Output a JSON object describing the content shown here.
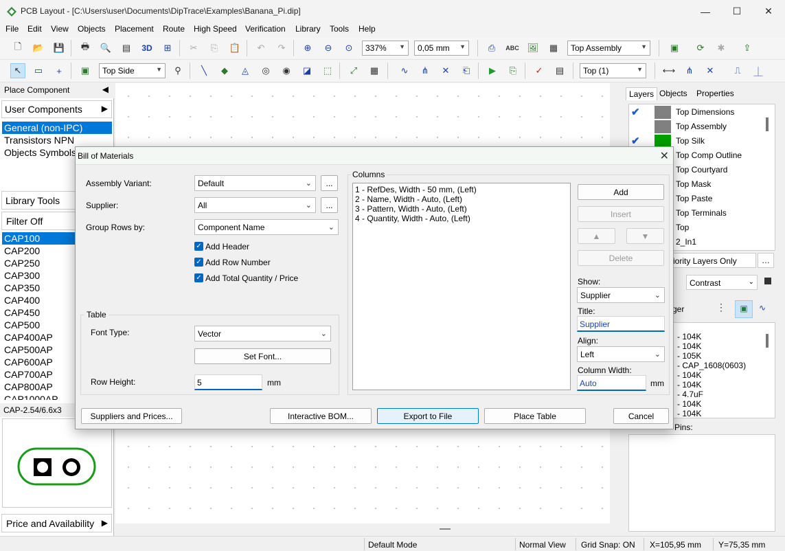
{
  "window": {
    "title": "PCB Layout - [C:\\Users\\user\\Documents\\DipTrace\\Examples\\Banana_Pi.dip]",
    "minimize": "—",
    "maximize": "☐",
    "close": "✕"
  },
  "menu": [
    "File",
    "Edit",
    "View",
    "Objects",
    "Placement",
    "Route",
    "High Speed",
    "Verification",
    "Library",
    "Tools",
    "Help"
  ],
  "toolbar1": {
    "zoom": "337%",
    "grid": "0,05 mm",
    "assembly": "Top Assembly",
    "abc": "ABC",
    "three_d": "3D"
  },
  "toolbar2": {
    "side": "Top Side",
    "layer": "Top (1)"
  },
  "left_panel": {
    "place_component": "Place Component",
    "user_components": "User Components",
    "libraries": [
      "General (non-IPC)",
      "Transistors NPN",
      "Objects Symbols"
    ],
    "library_tools": "Library Tools",
    "filter": "Filter Off",
    "components": [
      "CAP100",
      "CAP200",
      "CAP250",
      "CAP300",
      "CAP350",
      "CAP400",
      "CAP450",
      "CAP500",
      "CAP400AP",
      "CAP500AP",
      "CAP600AP",
      "CAP700AP",
      "CAP800AP",
      "CAP1000AP"
    ],
    "pattern_name": "CAP-2.54/6.6x3",
    "price_availability": "Price and Availability"
  },
  "right_panel": {
    "tabs": [
      "Layers",
      "Objects",
      "Properties"
    ],
    "layers": [
      {
        "name": "Top Dimensions",
        "checked": true,
        "color": "#808080"
      },
      {
        "name": "Top Assembly",
        "checked": false,
        "color": "#808080"
      },
      {
        "name": "Top Silk",
        "checked": true,
        "color": "#00a000"
      },
      {
        "name": "Top Comp Outline",
        "checked": false,
        "color": "#ffffff"
      },
      {
        "name": "Top Courtyard",
        "checked": false,
        "color": "#ffffff"
      },
      {
        "name": "Top Mask",
        "checked": false,
        "color": "#ffffff"
      },
      {
        "name": "Top Paste",
        "checked": false,
        "color": "#ffffff"
      },
      {
        "name": "Top Terminals",
        "checked": false,
        "color": "#ffffff"
      },
      {
        "name": "Top",
        "checked": false,
        "color": "#ffffff"
      },
      {
        "name": "2_In1",
        "checked": false,
        "color": "#ffffff"
      }
    ],
    "priority": "iority Layers Only",
    "contrast": "Contrast",
    "manager": "ger",
    "components": [
      "- 104K",
      "- 104K",
      "- 105K",
      "- CAP_1608(0603)",
      "- 104K",
      "- 104K",
      "- 4.7uF",
      "- 104K",
      "- 104K"
    ],
    "pins": "Pins:"
  },
  "dialog": {
    "title": "Bill of Materials",
    "assembly_variant_label": "Assembly Variant:",
    "assembly_variant": "Default",
    "supplier_label": "Supplier:",
    "supplier": "All",
    "group_rows_label": "Group Rows by:",
    "group_rows": "Component Name",
    "add_header": "Add Header",
    "add_row_number": "Add Row Number",
    "add_total": "Add Total Quantity / Price",
    "table_group": "Table",
    "font_type_label": "Font Type:",
    "font_type": "Vector",
    "set_font": "Set Font...",
    "row_height_label": "Row Height:",
    "row_height": "5",
    "row_height_unit": "mm",
    "columns_label": "Columns",
    "columns": [
      "1 - RefDes, Width - 50 mm, (Left)",
      "2 - Name, Width - Auto, (Left)",
      "3 - Pattern, Width - Auto, (Left)",
      "4 - Quantity, Width - Auto, (Left)"
    ],
    "add": "Add",
    "insert": "Insert",
    "delete": "Delete",
    "show_label": "Show:",
    "show": "Supplier",
    "title_label": "Title:",
    "title_value": "Supplier",
    "align_label": "Align:",
    "align": "Left",
    "col_width_label": "Column Width:",
    "col_width": "Auto",
    "col_width_unit": "mm",
    "ellipsis": "...",
    "suppliers_prices": "Suppliers and Prices...",
    "interactive_bom": "Interactive BOM...",
    "export": "Export to File",
    "place_table": "Place Table",
    "cancel": "Cancel"
  },
  "status": {
    "mode": "Default Mode",
    "view": "Normal View",
    "snap": "Grid Snap: ON",
    "x": "X=105,95 mm",
    "y": "Y=75,35 mm"
  },
  "colors": {
    "accent": "#0078d7",
    "checkbox": "#0067c0",
    "silk_green": "#00a000"
  }
}
